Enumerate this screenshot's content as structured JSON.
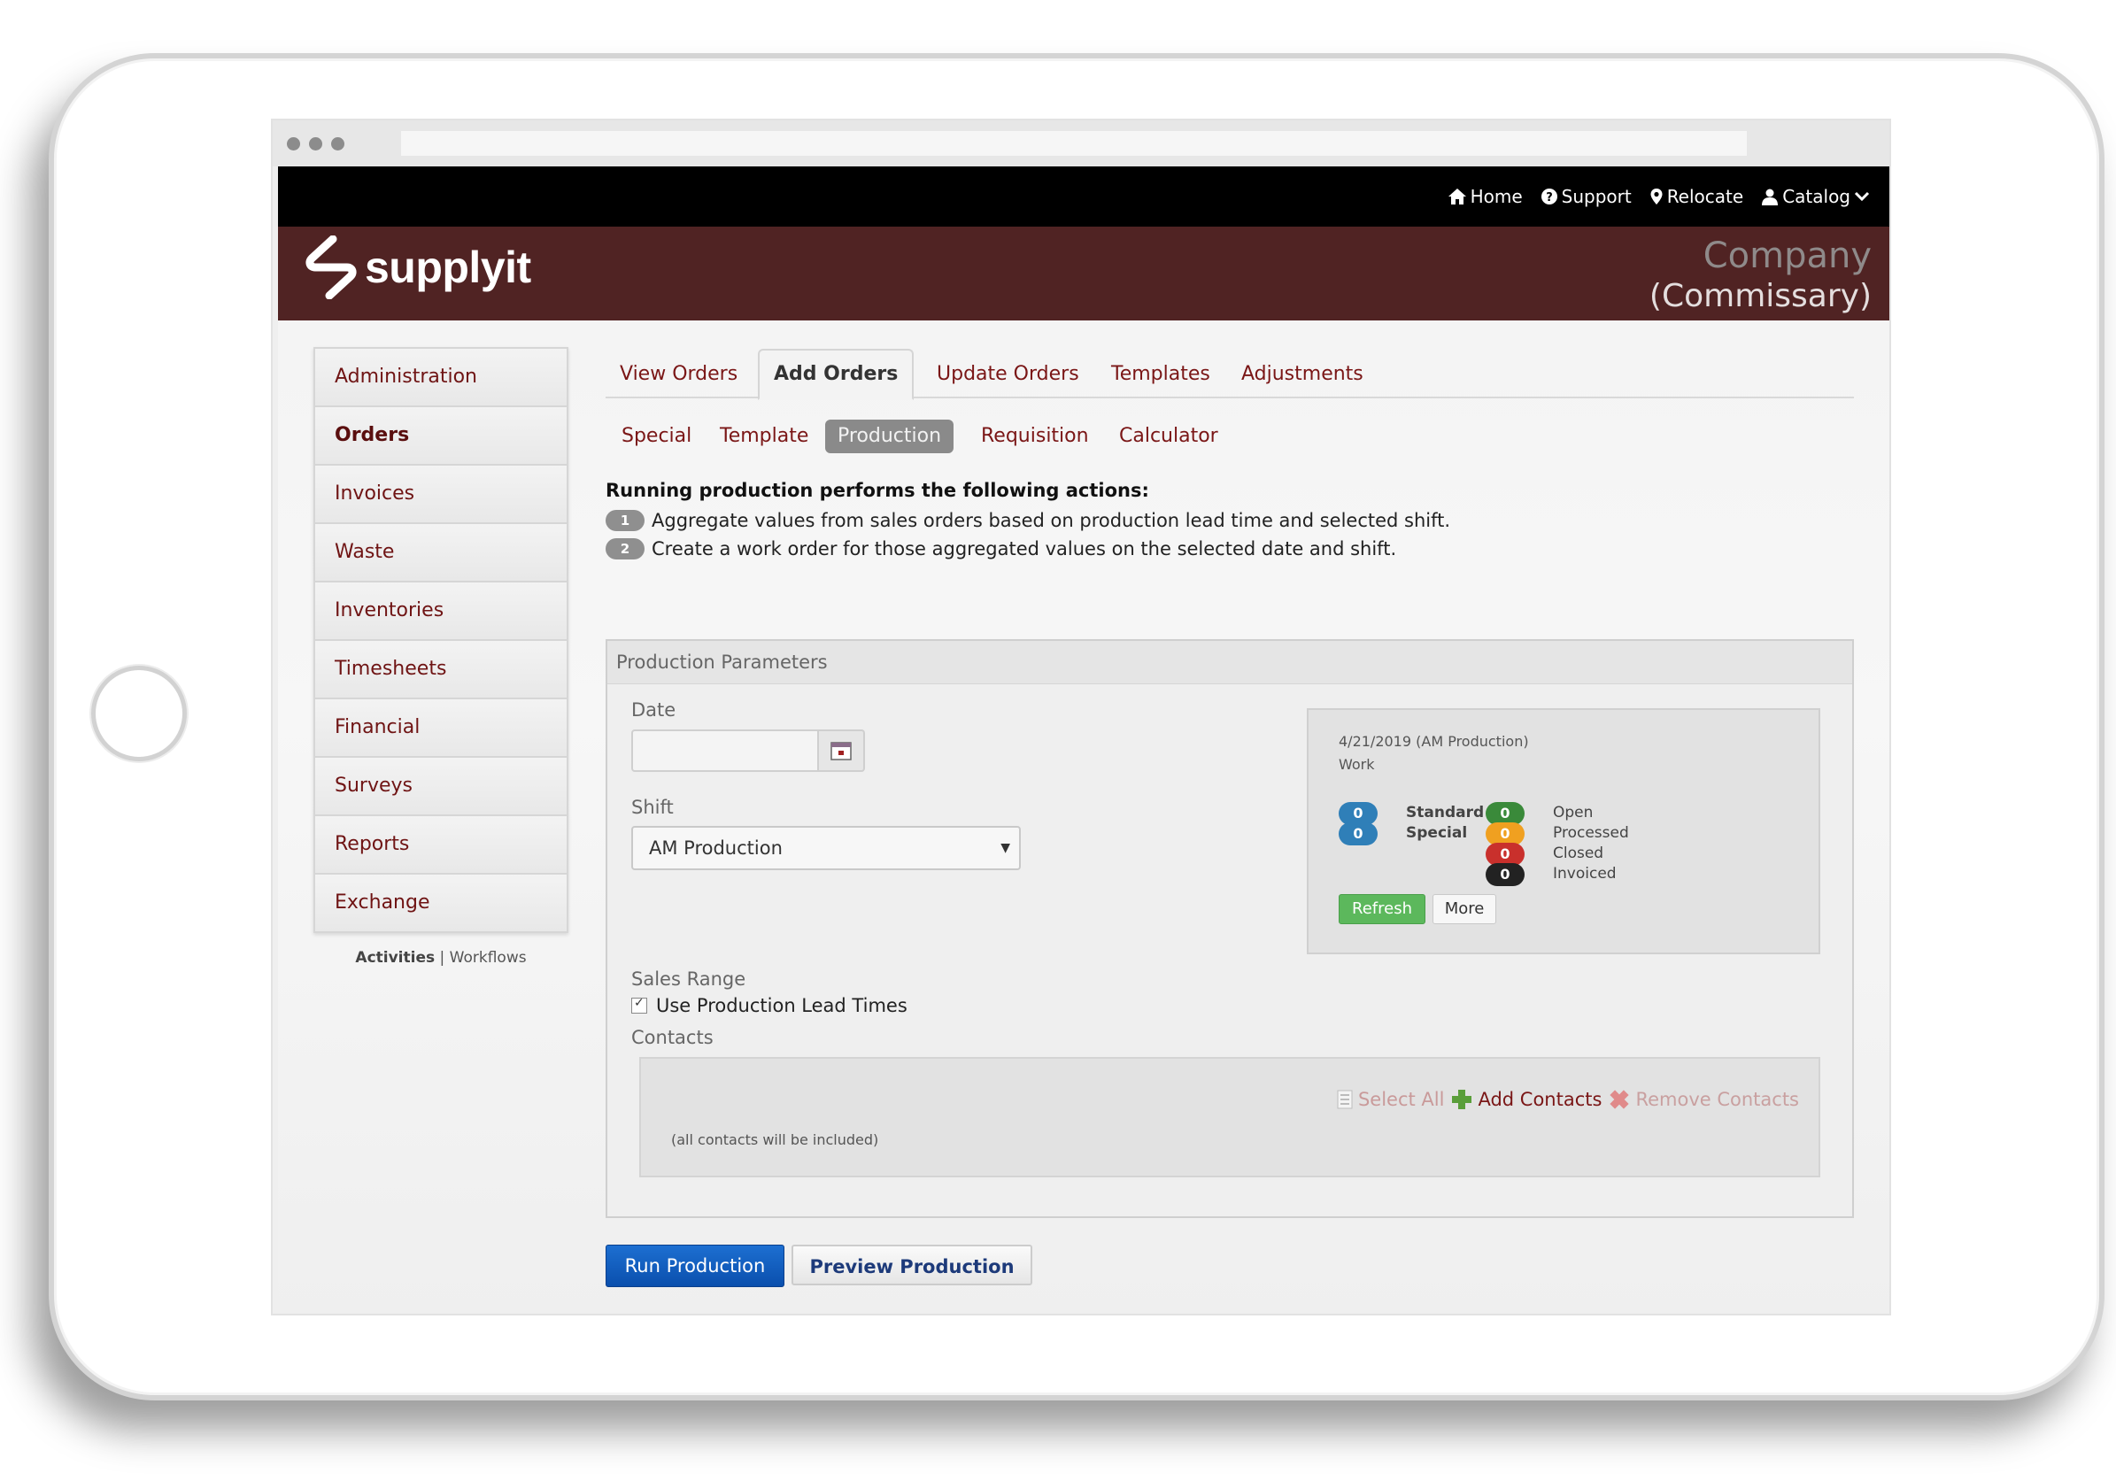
{
  "topnav": {
    "home": "Home",
    "support": "Support",
    "relocate": "Relocate",
    "catalog": "Catalog"
  },
  "brand": {
    "logo_text": "supplyit",
    "company_line1": "Company",
    "company_line2": "(Commissary)"
  },
  "sidebar": {
    "items": [
      {
        "label": "Administration"
      },
      {
        "label": "Orders"
      },
      {
        "label": "Invoices"
      },
      {
        "label": "Waste"
      },
      {
        "label": "Inventories"
      },
      {
        "label": "Timesheets"
      },
      {
        "label": "Financial"
      },
      {
        "label": "Surveys"
      },
      {
        "label": "Reports"
      },
      {
        "label": "Exchange"
      }
    ],
    "active": "Orders",
    "activities": "Activities",
    "separator": "|",
    "workflows": "Workflows"
  },
  "tabs": [
    {
      "label": "View Orders"
    },
    {
      "label": "Add Orders"
    },
    {
      "label": "Update Orders"
    },
    {
      "label": "Templates"
    },
    {
      "label": "Adjustments"
    }
  ],
  "subtabs": [
    {
      "label": "Special"
    },
    {
      "label": "Template"
    },
    {
      "label": "Production"
    },
    {
      "label": "Requisition"
    },
    {
      "label": "Calculator"
    }
  ],
  "intro": {
    "title": "Running production performs the following actions:",
    "steps": [
      {
        "num": "1",
        "text": "Aggregate values from sales orders based on production lead time and selected shift."
      },
      {
        "num": "2",
        "text": "Create a work order for those aggregated values on the selected date and shift."
      }
    ]
  },
  "panel": {
    "title": "Production Parameters",
    "date_label": "Date",
    "date_value": "",
    "shift_label": "Shift",
    "shift_value": "AM Production",
    "sales_range_label": "Sales Range",
    "lead_times_label": "Use Production Lead Times",
    "lead_times_checked": true,
    "contacts_label": "Contacts",
    "select_all": "Select All",
    "add_contacts": "Add Contacts",
    "remove_contacts": "Remove Contacts",
    "contacts_note": "(all contacts will be included)"
  },
  "status": {
    "date_line": "4/21/2019 (AM Production)",
    "work_line": "Work",
    "standard": {
      "count": "0",
      "label": "Standard"
    },
    "special": {
      "count": "0",
      "label": "Special"
    },
    "open": {
      "count": "0",
      "label": "Open",
      "color": "#3a8a3a"
    },
    "processed": {
      "count": "0",
      "label": "Processed",
      "color": "#f0a020"
    },
    "closed": {
      "count": "0",
      "label": "Closed",
      "color": "#c9302c"
    },
    "invoiced": {
      "count": "0",
      "label": "Invoiced",
      "color": "#222222"
    },
    "count_color": "#2f7fb8",
    "refresh": "Refresh",
    "more": "More"
  },
  "actions": {
    "run": "Run Production",
    "preview": "Preview Production"
  },
  "colors": {
    "brand_bar": "#502323",
    "link": "#7a1616",
    "run_button": "#0a4fad"
  }
}
